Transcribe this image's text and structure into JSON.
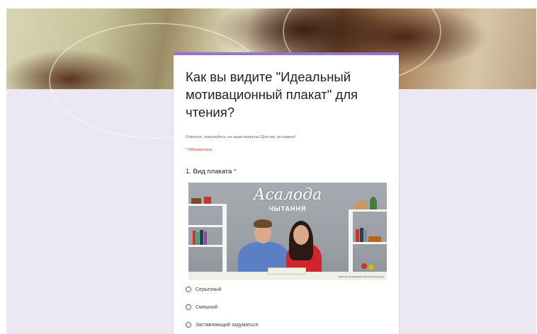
{
  "form": {
    "title": "Как вы видите \"Идеальный мотивационный плакат\" для чтения?",
    "description": "Ответьте, пожалуйста, на наши вопросы! Для нас это важно!",
    "required_note": "* Обязательно"
  },
  "question": {
    "label": "1. Вид плаката",
    "required_mark": "*",
    "image": {
      "headline": "Асалода",
      "subhead": "ЧЫТАННЯ",
      "caption": "Міністэрства інфармацыі Рэспублікі Беларусь"
    },
    "options": [
      {
        "label": "Серьезный"
      },
      {
        "label": "Смешной"
      },
      {
        "label": "Заставляющий задуматься"
      },
      {
        "label": ""
      }
    ]
  },
  "colors": {
    "accent": "#9572d6",
    "page_background": "#ebe7f3",
    "required": "#d93025"
  }
}
